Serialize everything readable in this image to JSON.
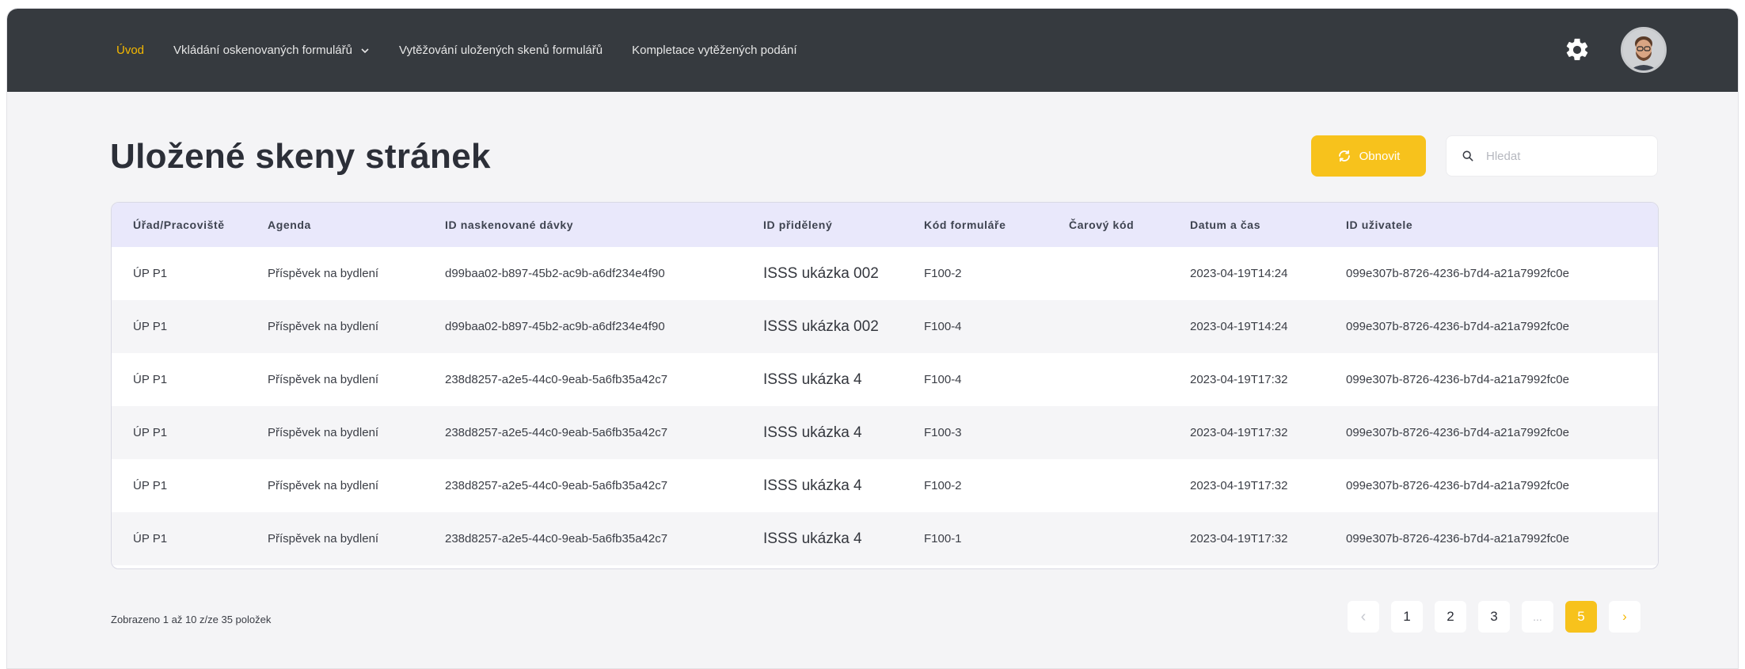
{
  "nav": {
    "items": [
      {
        "label": "Úvod",
        "active": true
      },
      {
        "label": "Vkládání oskenovaných formulářů",
        "dropdown": true
      },
      {
        "label": "Vytěžování uložených skenů formulářů"
      },
      {
        "label": "Kompletace vytěžených podání"
      }
    ],
    "settings_icon": "gear-icon",
    "avatar_icon": "user-avatar"
  },
  "page": {
    "title": "Uložené skeny stránek"
  },
  "toolbar": {
    "refresh_label": "Obnovit",
    "search_placeholder": "Hledat",
    "accent_color": "#f7c21c"
  },
  "table": {
    "columns": [
      "Úřad/Pracoviště",
      "Agenda",
      "ID naskenované dávky",
      "ID přidělený",
      "Kód formuláře",
      "Čarový kód",
      "Datum a čas",
      "ID uživatele"
    ],
    "rows": [
      [
        "ÚP P1",
        "Příspěvek na bydlení",
        "d99baa02-b897-45b2-ac9b-a6df234e4f90",
        "ISSS ukázka 002",
        "F100-2",
        "",
        "2023-04-19T14:24",
        "099e307b-8726-4236-b7d4-a21a7992fc0e"
      ],
      [
        "ÚP P1",
        "Příspěvek na bydlení",
        "d99baa02-b897-45b2-ac9b-a6df234e4f90",
        "ISSS ukázka 002",
        "F100-4",
        "",
        "2023-04-19T14:24",
        "099e307b-8726-4236-b7d4-a21a7992fc0e"
      ],
      [
        "ÚP P1",
        "Příspěvek na bydlení",
        "238d8257-a2e5-44c0-9eab-5a6fb35a42c7",
        "ISSS ukázka 4",
        "F100-4",
        "",
        "2023-04-19T17:32",
        "099e307b-8726-4236-b7d4-a21a7992fc0e"
      ],
      [
        "ÚP P1",
        "Příspěvek na bydlení",
        "238d8257-a2e5-44c0-9eab-5a6fb35a42c7",
        "ISSS ukázka 4",
        "F100-3",
        "",
        "2023-04-19T17:32",
        "099e307b-8726-4236-b7d4-a21a7992fc0e"
      ],
      [
        "ÚP P1",
        "Příspěvek na bydlení",
        "238d8257-a2e5-44c0-9eab-5a6fb35a42c7",
        "ISSS ukázka 4",
        "F100-2",
        "",
        "2023-04-19T17:32",
        "099e307b-8726-4236-b7d4-a21a7992fc0e"
      ],
      [
        "ÚP P1",
        "Příspěvek na bydlení",
        "238d8257-a2e5-44c0-9eab-5a6fb35a42c7",
        "ISSS ukázka 4",
        "F100-1",
        "",
        "2023-04-19T17:32",
        "099e307b-8726-4236-b7d4-a21a7992fc0e"
      ]
    ]
  },
  "footer": {
    "summary": "Zobrazeno 1 až 10 z/ze 35 položek",
    "pagination": {
      "prev": "‹",
      "pages": [
        "1",
        "2",
        "3"
      ],
      "ellipsis": "...",
      "current": "5",
      "next": "›"
    }
  }
}
